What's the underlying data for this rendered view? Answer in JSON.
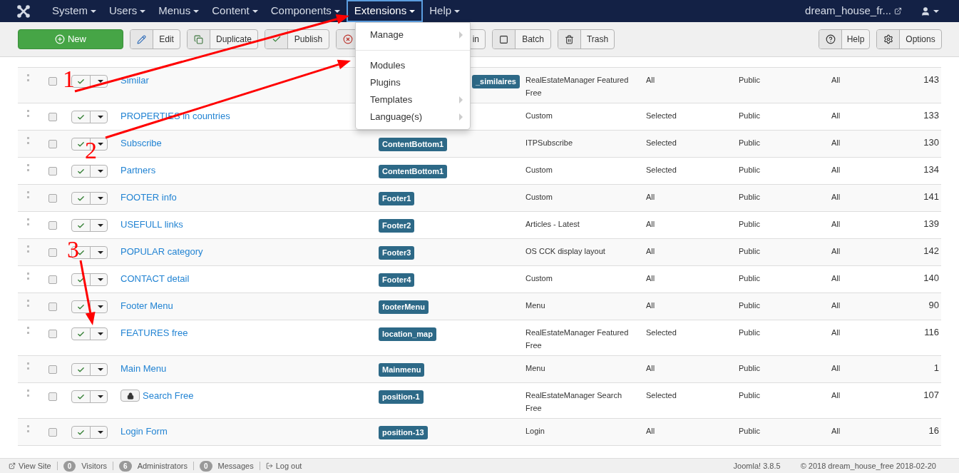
{
  "navbar": {
    "menus": [
      {
        "label": "System",
        "open": false
      },
      {
        "label": "Users",
        "open": false
      },
      {
        "label": "Menus",
        "open": false
      },
      {
        "label": "Content",
        "open": false
      },
      {
        "label": "Components",
        "open": false
      },
      {
        "label": "Extensions",
        "open": true
      },
      {
        "label": "Help",
        "open": false
      }
    ],
    "site_link": "dream_house_fr..."
  },
  "extensions_menu": [
    {
      "label": "Manage",
      "submenu": true,
      "kind": "item"
    },
    {
      "kind": "divider"
    },
    {
      "label": "Modules",
      "submenu": false,
      "kind": "item"
    },
    {
      "label": "Plugins",
      "submenu": false,
      "kind": "item"
    },
    {
      "label": "Templates",
      "submenu": true,
      "kind": "item"
    },
    {
      "label": "Language(s)",
      "submenu": true,
      "kind": "item"
    }
  ],
  "toolbar": [
    {
      "kind": "new",
      "label": "New"
    },
    {
      "kind": "edit",
      "label": "Edit"
    },
    {
      "kind": "duplicate",
      "label": "Duplicate"
    },
    {
      "kind": "publish",
      "label": "Publish"
    },
    {
      "kind": "unpublish",
      "label": "in"
    },
    {
      "kind": "batch",
      "label": "Batch"
    },
    {
      "kind": "trash",
      "label": "Trash"
    },
    {
      "kind": "help",
      "label": "Help"
    },
    {
      "kind": "options",
      "label": "Options"
    }
  ],
  "rows": [
    {
      "title": "Similar",
      "locked": false,
      "published": true,
      "selected": false,
      "position": "_similaires",
      "type": "RealEstateManager Featured Free",
      "pages": "All",
      "access": "Public",
      "language": "All",
      "id": "143"
    },
    {
      "title": "PROPERTIES in countries",
      "locked": false,
      "published": true,
      "selected": false,
      "position": "",
      "type": "Custom",
      "pages": "Selected",
      "access": "Public",
      "language": "All",
      "id": "133"
    },
    {
      "title": "Subscribe",
      "locked": false,
      "published": true,
      "selected": false,
      "position": "ContentBottom1",
      "type": "ITPSubscribe",
      "pages": "Selected",
      "access": "Public",
      "language": "All",
      "id": "130"
    },
    {
      "title": "Partners",
      "locked": false,
      "published": true,
      "selected": false,
      "position": "ContentBottom1",
      "type": "Custom",
      "pages": "Selected",
      "access": "Public",
      "language": "All",
      "id": "134"
    },
    {
      "title": "FOOTER info",
      "locked": false,
      "published": true,
      "selected": false,
      "position": "Footer1",
      "type": "Custom",
      "pages": "All",
      "access": "Public",
      "language": "All",
      "id": "141"
    },
    {
      "title": "USEFULL links",
      "locked": false,
      "published": true,
      "selected": false,
      "position": "Footer2",
      "type": "Articles - Latest",
      "pages": "All",
      "access": "Public",
      "language": "All",
      "id": "139"
    },
    {
      "title": "POPULAR category",
      "locked": false,
      "published": true,
      "selected": false,
      "position": "Footer3",
      "type": "OS CCK display layout",
      "pages": "All",
      "access": "Public",
      "language": "All",
      "id": "142"
    },
    {
      "title": "CONTACT detail",
      "locked": false,
      "published": true,
      "selected": false,
      "position": "Footer4",
      "type": "Custom",
      "pages": "All",
      "access": "Public",
      "language": "All",
      "id": "140"
    },
    {
      "title": "Footer Menu",
      "locked": false,
      "published": true,
      "selected": false,
      "position": "footerMenu",
      "type": "Menu",
      "pages": "All",
      "access": "Public",
      "language": "All",
      "id": "90"
    },
    {
      "title": "FEATURES free",
      "locked": false,
      "published": true,
      "selected": false,
      "position": "location_map",
      "type": "RealEstateManager Featured Free",
      "pages": "Selected",
      "access": "Public",
      "language": "All",
      "id": "116"
    },
    {
      "title": "Main Menu",
      "locked": false,
      "published": true,
      "selected": false,
      "position": "Mainmenu",
      "type": "Menu",
      "pages": "All",
      "access": "Public",
      "language": "All",
      "id": "1"
    },
    {
      "title": "Search Free",
      "locked": true,
      "published": true,
      "selected": false,
      "position": "position-1",
      "type": "RealEstateManager Search Free",
      "pages": "Selected",
      "access": "Public",
      "language": "All",
      "id": "107"
    },
    {
      "title": "Login Form",
      "locked": false,
      "published": true,
      "selected": false,
      "position": "position-13",
      "type": "Login",
      "pages": "All",
      "access": "Public",
      "language": "All",
      "id": "16"
    }
  ],
  "status_bar": {
    "view_site": "View Site",
    "counters": [
      {
        "count": "0",
        "label": "Visitors"
      },
      {
        "count": "6",
        "label": "Administrators"
      },
      {
        "count": "0",
        "label": "Messages"
      }
    ],
    "logout": "Log out",
    "version": "Joomla! 3.8.5",
    "copyright": "© 2018 dream_house_free 2018-02-20"
  },
  "annotations": [
    {
      "label": "1"
    },
    {
      "label": "2"
    },
    {
      "label": "3"
    }
  ]
}
